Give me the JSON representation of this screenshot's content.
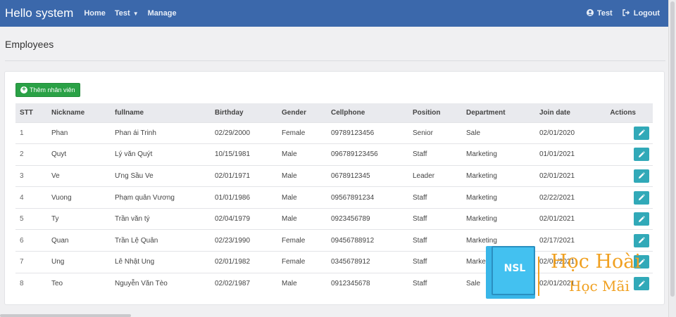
{
  "navbar": {
    "brand": "Hello system",
    "links": [
      "Home",
      "Test",
      "Manage"
    ],
    "user": "Test",
    "logout": "Logout"
  },
  "page": {
    "title": "Employees",
    "add_button": "Thêm nhân viên"
  },
  "table": {
    "headers": [
      "STT",
      "Nickname",
      "fullname",
      "Birthday",
      "Gender",
      "Cellphone",
      "Position",
      "Department",
      "Join date",
      "Actions"
    ],
    "rows": [
      [
        "1",
        "Phan",
        "Phan ái Trinh",
        "02/29/2000",
        "Female",
        "09789123456",
        "Senior",
        "Sale",
        "02/01/2020"
      ],
      [
        "2",
        "Quyt",
        "Lý văn Quýt",
        "10/15/1981",
        "Male",
        "096789123456",
        "Staff",
        "Marketing",
        "01/01/2021"
      ],
      [
        "3",
        "Ve",
        "Ưng Sầu Ve",
        "02/01/1971",
        "Male",
        "0678912345",
        "Leader",
        "Marketing",
        "02/01/2021"
      ],
      [
        "4",
        "Vuong",
        "Phạm quân Vương",
        "01/01/1986",
        "Male",
        "09567891234",
        "Staff",
        "Marketing",
        "02/22/2021"
      ],
      [
        "5",
        "Ty",
        "Trần văn tý",
        "02/04/1979",
        "Male",
        "0923456789",
        "Staff",
        "Marketing",
        "02/01/2021"
      ],
      [
        "6",
        "Quan",
        "Trần Lệ Quân",
        "02/23/1990",
        "Female",
        "09456788912",
        "Staff",
        "Marketing",
        "02/17/2021"
      ],
      [
        "7",
        "Ung",
        "Lê Nhật Ung",
        "02/01/1982",
        "Female",
        "0345678912",
        "Staff",
        "Marke",
        "02/01/2021"
      ],
      [
        "8",
        "Teo",
        "Nguyễn Văn Tèo",
        "02/02/1987",
        "Male",
        "0912345678",
        "Staff",
        "Sale",
        "02/01/2021"
      ]
    ]
  },
  "watermark": {
    "badge": "NSL",
    "line1": "Học Hoài",
    "line2": "Học Mãi"
  },
  "colors": {
    "navbar": "#3b68ab",
    "add_button": "#2aa146",
    "edit_button": "#31a9b8",
    "watermark_orange": "#f0a020",
    "watermark_blue": "#39b6e8"
  }
}
